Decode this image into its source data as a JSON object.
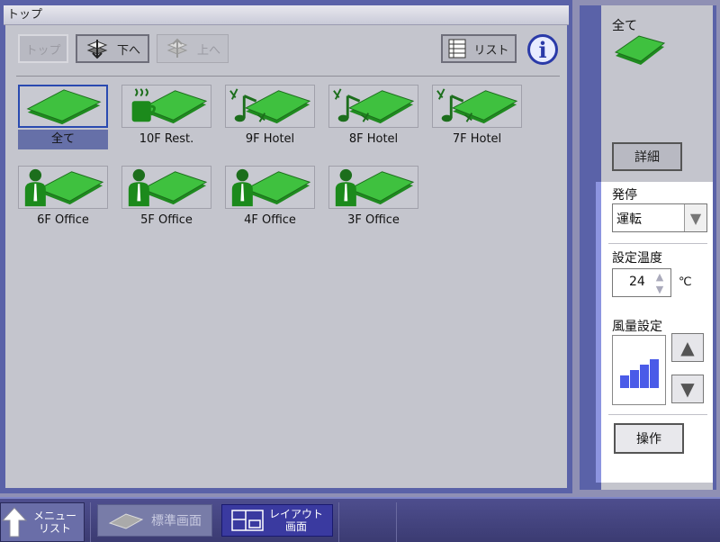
{
  "main": {
    "title": "トップ",
    "toolbar": {
      "top_label": "トップ",
      "down_label": "下へ",
      "up_label": "上へ",
      "list_label": "リスト",
      "info_glyph": "i"
    },
    "zones": [
      {
        "label": "全て",
        "icon": "floor-icon",
        "selected": true
      },
      {
        "label": "10F Rest.",
        "icon": "coffee-icon"
      },
      {
        "label": "9F Hotel",
        "icon": "music-icon"
      },
      {
        "label": "8F Hotel",
        "icon": "music-icon"
      },
      {
        "label": "7F Hotel",
        "icon": "music-icon"
      },
      {
        "label": "6F Office",
        "icon": "person-icon"
      },
      {
        "label": "5F Office",
        "icon": "person-icon"
      },
      {
        "label": "4F Office",
        "icon": "person-icon"
      },
      {
        "label": "3F Office",
        "icon": "person-icon"
      }
    ]
  },
  "side": {
    "selected_label": "全て",
    "detail_label": "詳細",
    "run_stop_label": "発停",
    "run_stop_value": "運転",
    "temp_label": "設定温度",
    "temp_value": "24",
    "temp_unit": "℃",
    "fan_label": "風量設定",
    "fan_level_fraction": 1.0,
    "operate_label": "操作"
  },
  "footer": {
    "menu_label_line1": "メニュー",
    "menu_label_line2": "リスト",
    "standard_label": "標準画面",
    "layout_label_line1": "レイアウト",
    "layout_label_line2": "画面"
  },
  "colors": {
    "accent": "#2a4ab0",
    "panel_bg": "#c4c5cd",
    "frame": "#5a62a8",
    "green": "#2ea82e"
  }
}
